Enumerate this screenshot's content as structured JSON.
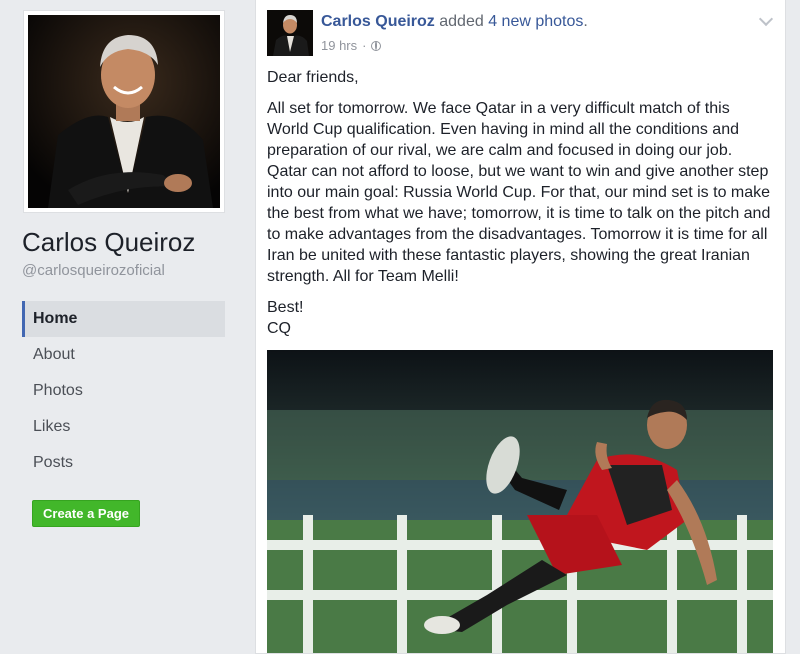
{
  "sidebar": {
    "page_name": "Carlos Queiroz",
    "page_handle": "@carlosqueirozoficial",
    "nav_items": [
      {
        "label": "Home",
        "active": true
      },
      {
        "label": "About",
        "active": false
      },
      {
        "label": "Photos",
        "active": false
      },
      {
        "label": "Likes",
        "active": false
      },
      {
        "label": "Posts",
        "active": false
      }
    ],
    "create_page_label": "Create a Page"
  },
  "post": {
    "author": "Carlos Queiroz",
    "action_prefix": " added ",
    "action_link": "4 new photos",
    "action_suffix": ".",
    "timestamp": "19 hrs",
    "meta_separator": "·",
    "privacy_icon": "globe-icon",
    "paragraphs": [
      "Dear friends,",
      "All set for tomorrow. We face Qatar in a very difficult match of this World Cup qualification. Even having in mind all the conditions and preparation of our rival, we are calm and focused in doing our job. Qatar can not afford to loose, but we want to win and give another step into our main goal: Russia World Cup. For that, our mind set is to make the best from what we have; tomorrow, it is time to talk on the pitch and to make advantages from the disadvantages. Tomorrow it is time for all Iran be united with these fantastic players, showing the great Iranian strength. All for Team Melli!",
      "Best!\nCQ"
    ]
  },
  "colors": {
    "link": "#385898",
    "accent": "#4267b2",
    "create_button": "#42b72a",
    "background": "#e9ebee"
  }
}
